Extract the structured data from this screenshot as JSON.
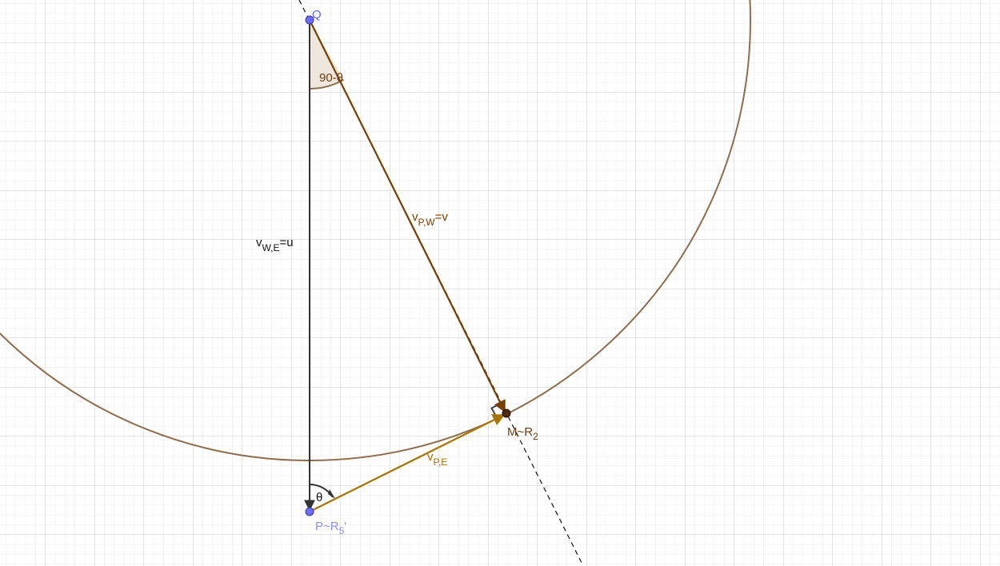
{
  "app": "GeoGebra geometry view",
  "colors": {
    "grid_minor": "#ececec",
    "grid_major": "#c8c8c8",
    "circle": "#8d6e4f",
    "vector_vpw": "#7a4000",
    "vector_vpe": "#a87400",
    "vector_vwe": "#333333",
    "point_blue": "#6b6bff",
    "point_dark": "#4a2a10",
    "angle_fill": "#efe6dd",
    "angle_stroke": "#8d6e4f",
    "label_blue": "#6666ee",
    "label_brown": "#6b3d10",
    "label_gold": "#a07000",
    "label_black": "#111111"
  },
  "points": {
    "Q": {
      "label": "Q"
    },
    "P": {
      "label": "P~R",
      "sub": "5",
      "suffix": "'"
    },
    "M": {
      "label": "M~R",
      "sub": "2"
    }
  },
  "vectors": {
    "vwe": {
      "label": "v",
      "sub": "W,E",
      "suffix": "=u"
    },
    "vpw": {
      "label": "v",
      "sub": "P,W",
      "suffix": "=v"
    },
    "vpe": {
      "label": "v",
      "sub": "P,E",
      "suffix": ""
    }
  },
  "angles": {
    "top": {
      "label": "90-θ"
    },
    "bottom": {
      "label": "θ"
    }
  }
}
